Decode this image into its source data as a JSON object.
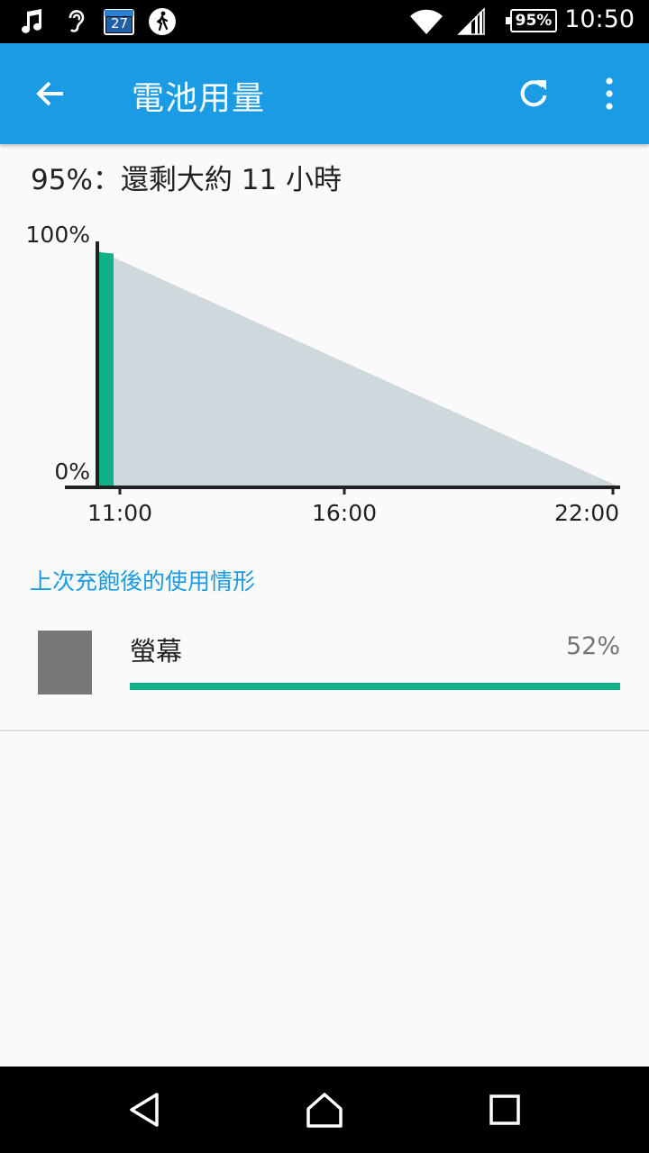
{
  "status_bar": {
    "time": "10:50",
    "battery_level": "95%",
    "calendar_date": "27",
    "icons": [
      "music-note-icon",
      "hearing-icon",
      "calendar-icon",
      "walking-icon",
      "wifi-icon",
      "cell-signal-icon",
      "battery-icon"
    ]
  },
  "app_bar": {
    "title": "電池用量",
    "back_icon": "arrow-back-icon",
    "refresh_icon": "refresh-icon",
    "more_icon": "more-vert-icon"
  },
  "summary": {
    "text": "95%：還剩大約 11 小時"
  },
  "chart_data": {
    "type": "area",
    "y_labels": [
      "100%",
      "0%"
    ],
    "x_tick_labels": [
      "11:00",
      "16:00",
      "22:00"
    ],
    "ylim": [
      0,
      100
    ],
    "series": [
      {
        "x": [
          "10:50",
          "11:00"
        ],
        "y": [
          100,
          95
        ],
        "color": "#12b08a"
      },
      {
        "x": [
          "11:00",
          "22:00"
        ],
        "y": [
          95,
          0
        ],
        "color": "#cfd8dc"
      }
    ],
    "grid": false
  },
  "section": {
    "title": "上次充飽後的使用情形"
  },
  "usage_items": [
    {
      "label": "螢幕",
      "percent": "52%",
      "fraction": 1.0,
      "bar_color": "#12b08a"
    }
  ],
  "nav_bar": {
    "icons": [
      "back-triangle-icon",
      "home-icon",
      "recents-square-icon"
    ]
  }
}
